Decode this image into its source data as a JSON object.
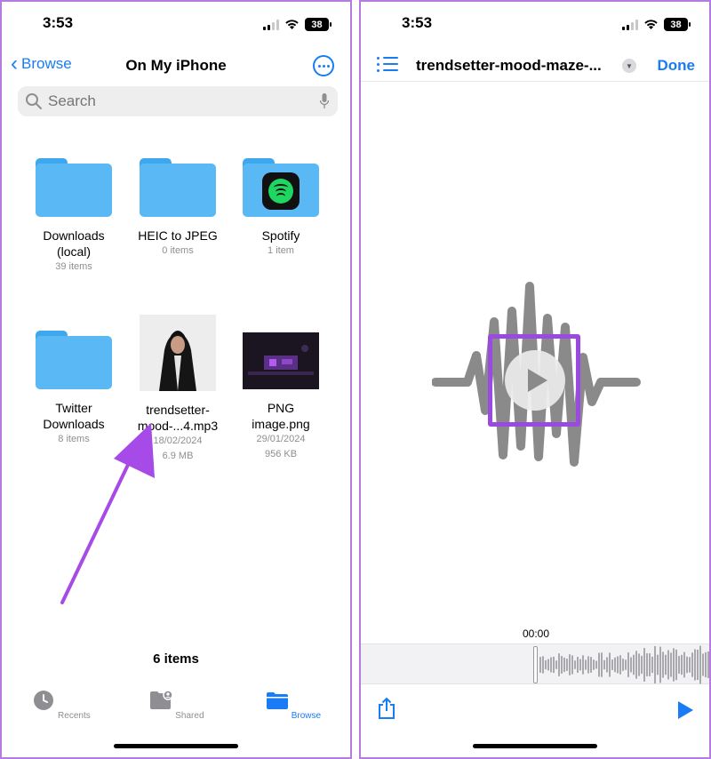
{
  "left": {
    "status": {
      "time": "3:53",
      "battery": "38"
    },
    "nav": {
      "back_label": "Browse",
      "title": "On My iPhone"
    },
    "search": {
      "placeholder": "Search"
    },
    "items": [
      {
        "name": "Downloads\n(local)",
        "meta": [
          "39 items"
        ],
        "type": "folder"
      },
      {
        "name": "HEIC to JPEG",
        "meta": [
          "0 items"
        ],
        "type": "folder"
      },
      {
        "name": "Spotify",
        "meta": [
          "1 item"
        ],
        "type": "folder-spotify"
      },
      {
        "name": "Twitter\nDownloads",
        "meta": [
          "8 items"
        ],
        "type": "folder"
      },
      {
        "name": "trendsetter-\nmood-...4.mp3",
        "meta": [
          "18/02/2024",
          "6.9 MB"
        ],
        "type": "audio-thumb"
      },
      {
        "name": "PNG\nimage.png",
        "meta": [
          "29/01/2024",
          "956 KB"
        ],
        "type": "image-thumb"
      }
    ],
    "footer_count": "6 items",
    "tabs": [
      {
        "label": "Recents",
        "icon": "clock-icon",
        "active": false
      },
      {
        "label": "Shared",
        "icon": "shared-folder-icon",
        "active": false
      },
      {
        "label": "Browse",
        "icon": "folder-icon",
        "active": true
      }
    ],
    "accent_color": "#1a7cf5",
    "annotation_color": "#a64ae8"
  },
  "right": {
    "status": {
      "time": "3:53",
      "battery": "38"
    },
    "nav": {
      "title": "trendsetter-mood-maze-...",
      "done_label": "Done"
    },
    "timestamp": "00:00",
    "icons": [
      "list-icon",
      "chevron-down-icon",
      "play-icon",
      "share-icon"
    ]
  }
}
